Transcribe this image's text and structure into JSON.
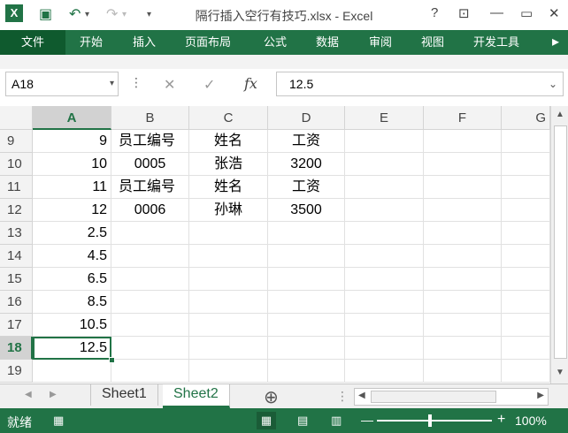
{
  "window": {
    "title": "隔行插入空行有技巧.xlsx - Excel",
    "help": "?",
    "minimize": "—",
    "restore": "▭",
    "close": "✕"
  },
  "ribbon": {
    "tabs": [
      "文件",
      "开始",
      "插入",
      "页面布局",
      "公式",
      "数据",
      "审阅",
      "视图",
      "开发工具"
    ]
  },
  "formula": {
    "namebox": "A18",
    "cancel": "✕",
    "confirm": "✓",
    "fx": "fx",
    "value": "12.5"
  },
  "columns": [
    "A",
    "B",
    "C",
    "D",
    "E",
    "F",
    "G"
  ],
  "rows": [
    {
      "n": "9",
      "A": "9",
      "B": "员工编号",
      "C": "姓名",
      "D": "工资"
    },
    {
      "n": "10",
      "A": "10",
      "B": "0005",
      "C": "张浩",
      "D": "3200"
    },
    {
      "n": "11",
      "A": "11",
      "B": "员工编号",
      "C": "姓名",
      "D": "工资"
    },
    {
      "n": "12",
      "A": "12",
      "B": "0006",
      "C": "孙琳",
      "D": "3500"
    },
    {
      "n": "13",
      "A": "2.5",
      "B": "",
      "C": "",
      "D": ""
    },
    {
      "n": "14",
      "A": "4.5",
      "B": "",
      "C": "",
      "D": ""
    },
    {
      "n": "15",
      "A": "6.5",
      "B": "",
      "C": "",
      "D": ""
    },
    {
      "n": "16",
      "A": "8.5",
      "B": "",
      "C": "",
      "D": ""
    },
    {
      "n": "17",
      "A": "10.5",
      "B": "",
      "C": "",
      "D": ""
    },
    {
      "n": "18",
      "A": "12.5",
      "B": "",
      "C": "",
      "D": ""
    },
    {
      "n": "19",
      "A": "",
      "B": "",
      "C": "",
      "D": ""
    }
  ],
  "sheets": [
    "Sheet1",
    "Sheet2"
  ],
  "add_sheet": "⊕",
  "status": {
    "ready": "就绪",
    "zoom": "100%",
    "zoom_minus": "—",
    "zoom_plus": "+"
  },
  "colors": {
    "accent": "#217346"
  }
}
